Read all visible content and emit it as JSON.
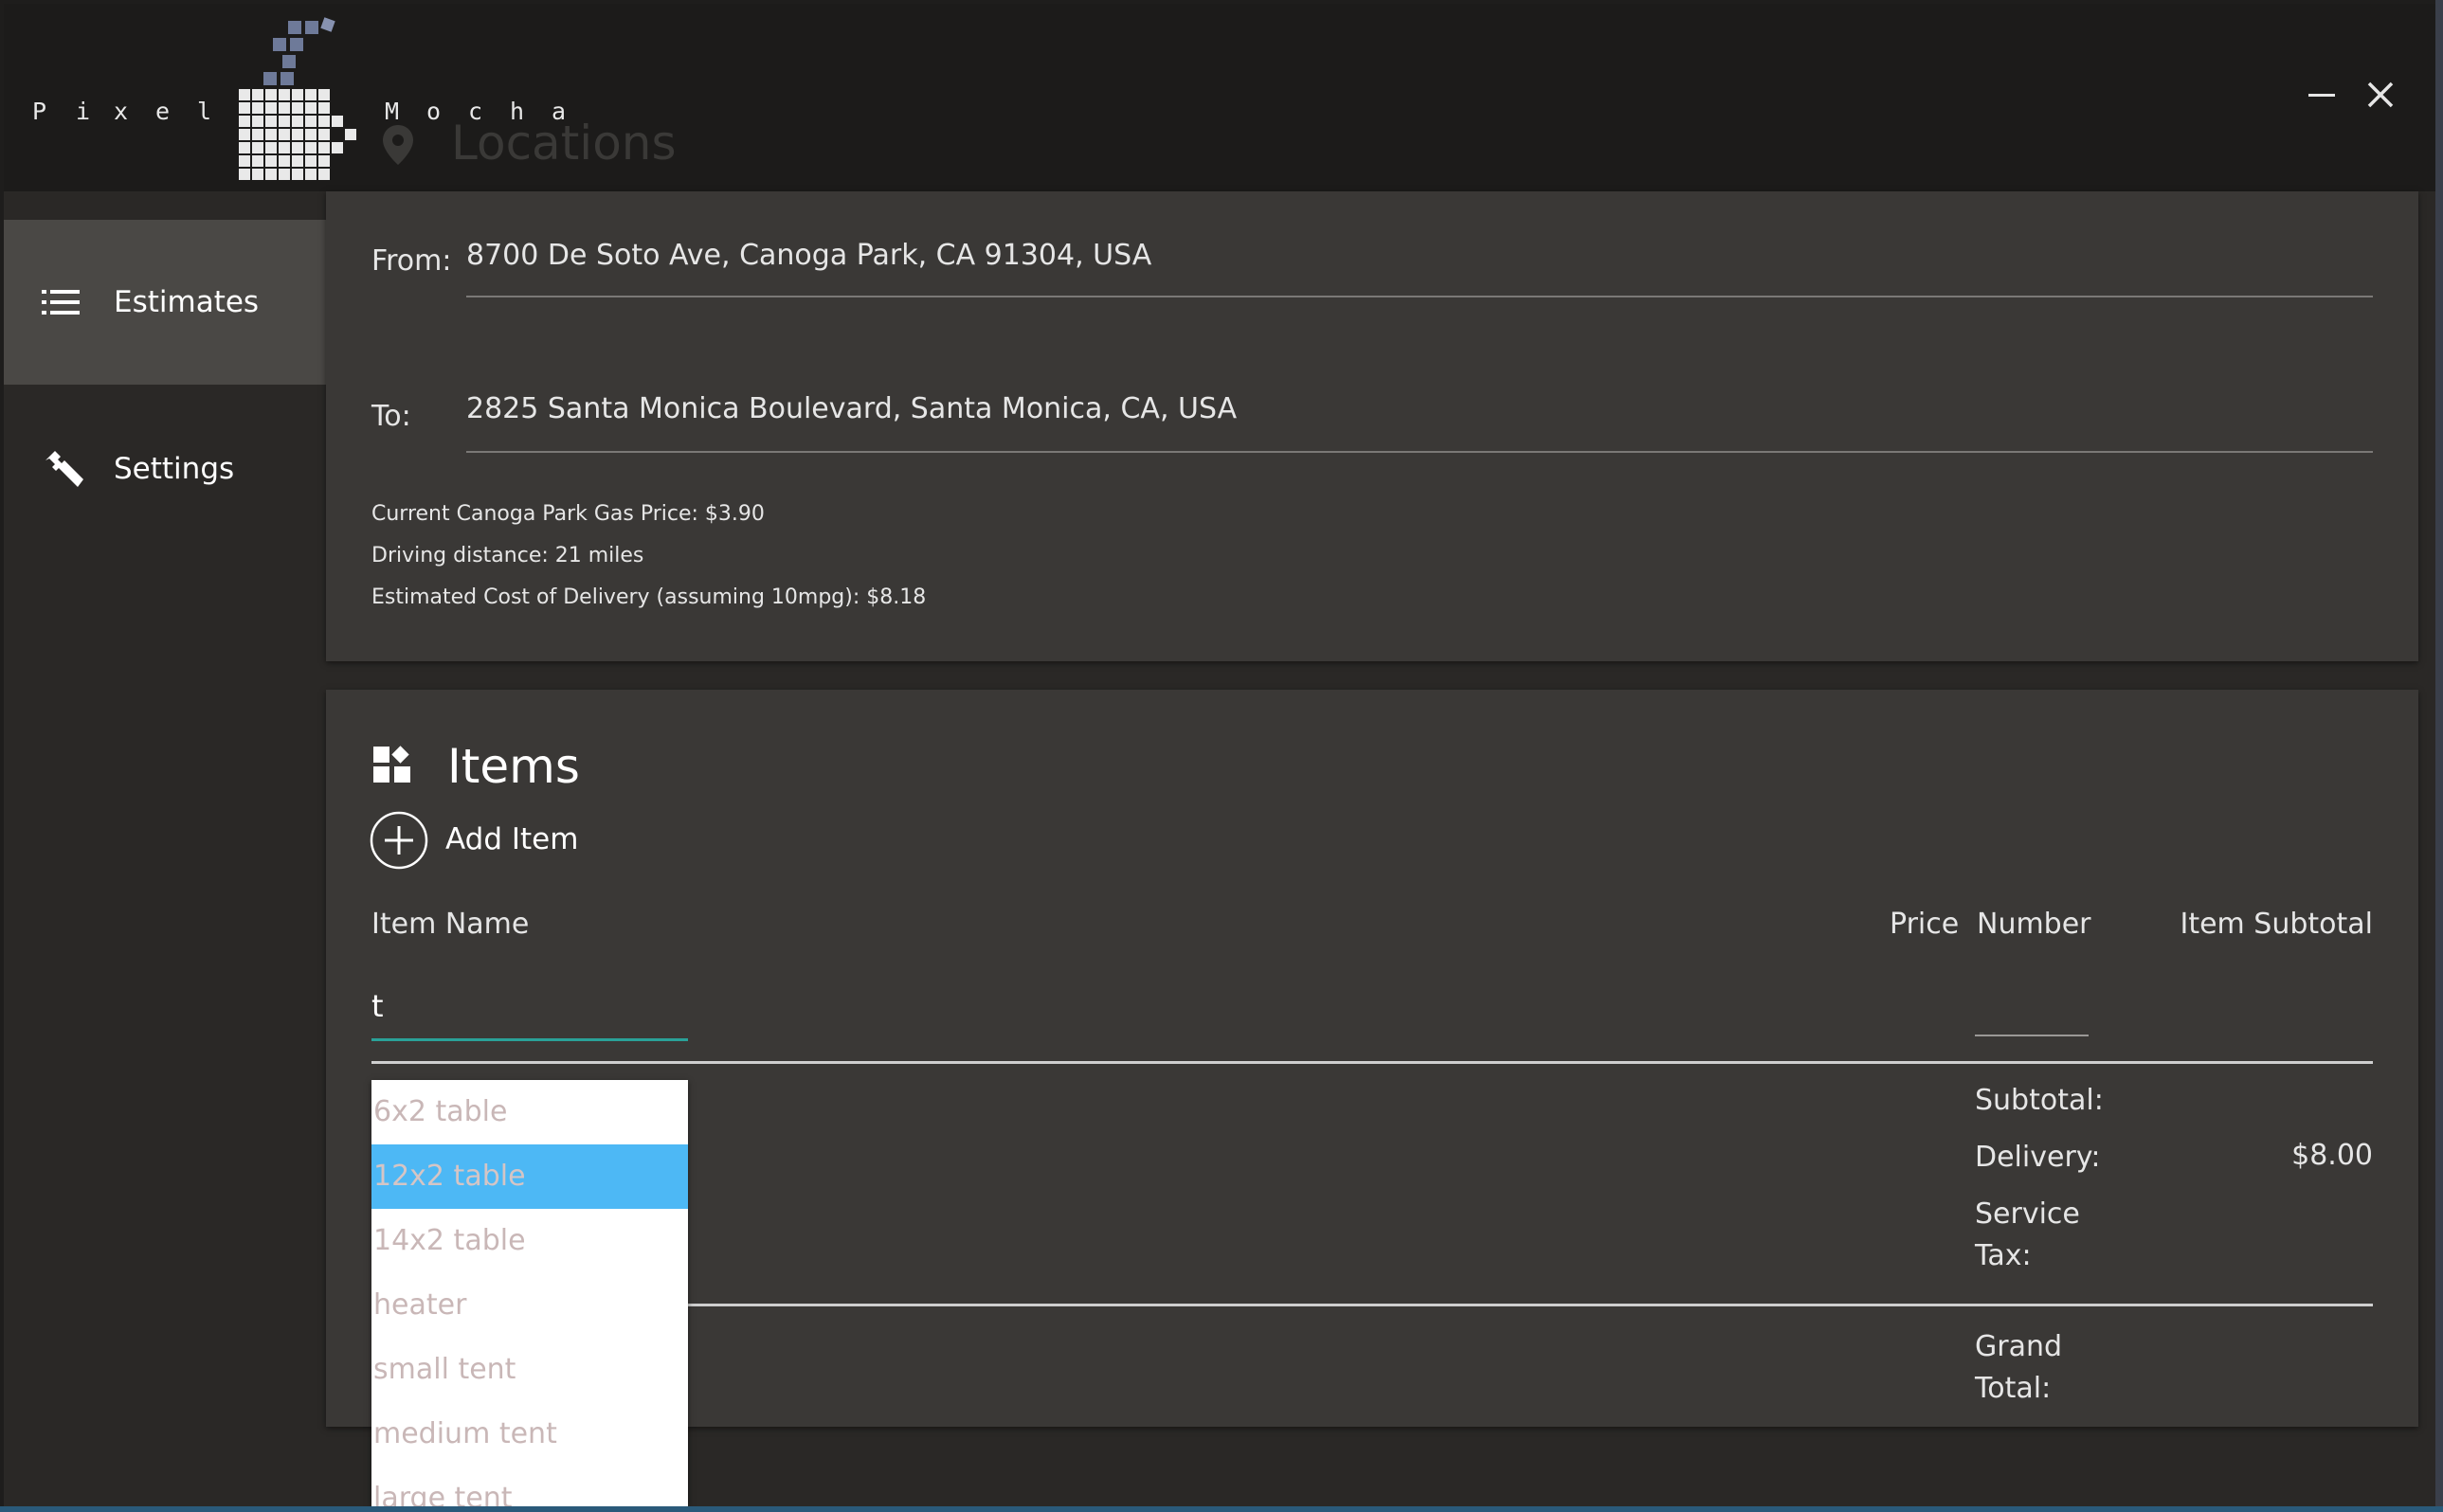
{
  "app": {
    "logo_letters_left": [
      "P",
      "i",
      "x",
      "e",
      "l"
    ],
    "logo_letters_right": [
      "M",
      "o",
      "c",
      "h",
      "a"
    ],
    "background_title": "Locations"
  },
  "window_controls": {
    "minimize_icon": "minus-icon",
    "close_icon": "close-icon"
  },
  "sidebar": {
    "items": [
      {
        "label": "Estimates",
        "icon": "list-icon",
        "active": true
      },
      {
        "label": "Settings",
        "icon": "wrench-icon",
        "active": false
      }
    ]
  },
  "locations": {
    "from_label": "From:",
    "from_value": "8700 De Soto Ave, Canoga Park, CA 91304, USA",
    "to_label": "To:",
    "to_value": "2825 Santa Monica Boulevard, Santa Monica, CA, USA",
    "gas_price": "Current Canoga Park Gas Price: $3.90",
    "distance": "Driving distance: 21 miles",
    "delivery_cost": "Estimated Cost of Delivery (assuming 10mpg): $8.18"
  },
  "items": {
    "title": "Items",
    "add_item_label": "Add Item",
    "columns": {
      "name": "Item Name",
      "price": "Price",
      "number": "Number",
      "subtotal": "Item Subtotal"
    },
    "name_input_value": "t",
    "number_input_value": ""
  },
  "summary": {
    "subtotal_label": "Subtotal:",
    "delivery_label": "Delivery:",
    "delivery_value": "$8.00",
    "tax_label_1": "Service",
    "tax_label_2": "Tax:",
    "grand_label_1": "Grand",
    "grand_label_2": "Total:"
  },
  "dropdown": {
    "options": [
      "6x2 table",
      "12x2 table",
      "14x2 table",
      "heater",
      "small tent",
      "medium tent",
      "large tent"
    ],
    "selected_index": 1
  },
  "colors": {
    "accent_underline": "#2aa198",
    "dropdown_highlight": "#4db8f5",
    "card": "#3a3836",
    "sidebar_active": "#4a4845"
  }
}
